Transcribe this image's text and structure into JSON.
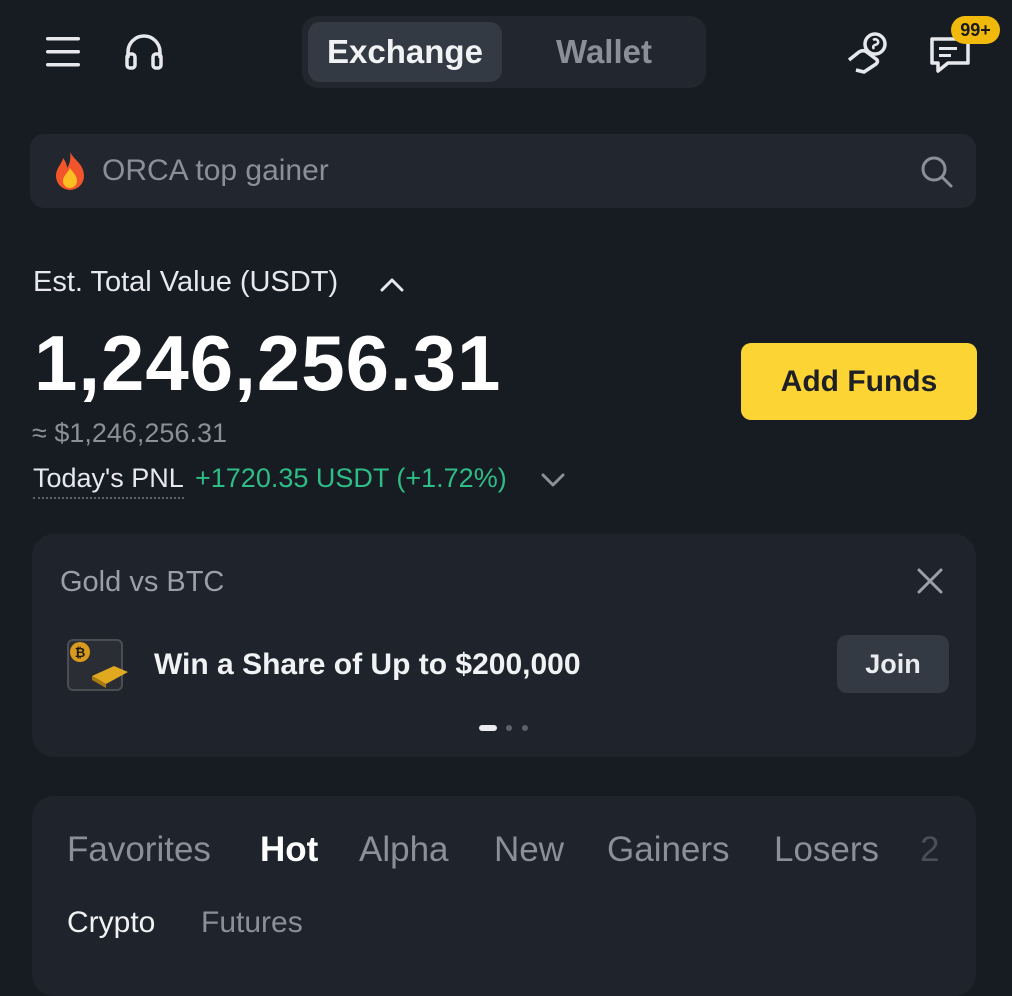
{
  "header": {
    "menu_icon": "hamburger-menu-icon",
    "support_icon": "headset-icon",
    "tabs": [
      {
        "label": "Exchange",
        "active": true
      },
      {
        "label": "Wallet",
        "active": false
      }
    ],
    "reward_icon": "hand-with-coin-icon",
    "messages_icon": "chat-message-icon",
    "messages_badge": "99+"
  },
  "search": {
    "icon": "fire-icon",
    "placeholder": "ORCA top gainer",
    "search_icon": "magnifier-icon"
  },
  "balance": {
    "label": "Est. Total Value (USDT)",
    "value": "1,246,256.31",
    "approx": "≈ $1,246,256.31",
    "pnl_label": "Today's PNL",
    "pnl_value": "+1720.35 USDT (+1.72%)",
    "add_funds_label": "Add Funds"
  },
  "promo": {
    "title": "Gold vs BTC",
    "text": "Win a Share of Up to $200,000",
    "join_label": "Join",
    "image": "gold-btc-wallet-image",
    "pages": 3,
    "active_page": 1
  },
  "market": {
    "tabs": [
      "Favorites",
      "Hot",
      "Alpha",
      "New",
      "Gainers",
      "Losers",
      "2"
    ],
    "active_tab": "Hot",
    "subtabs": [
      "Crypto",
      "Futures"
    ],
    "active_subtab": "Crypto"
  },
  "colors": {
    "background": "#171b22",
    "card": "#1f242c",
    "accent_yellow": "#fcd535",
    "positive_green": "#2ebd85",
    "badge_yellow": "#f0b90b"
  }
}
